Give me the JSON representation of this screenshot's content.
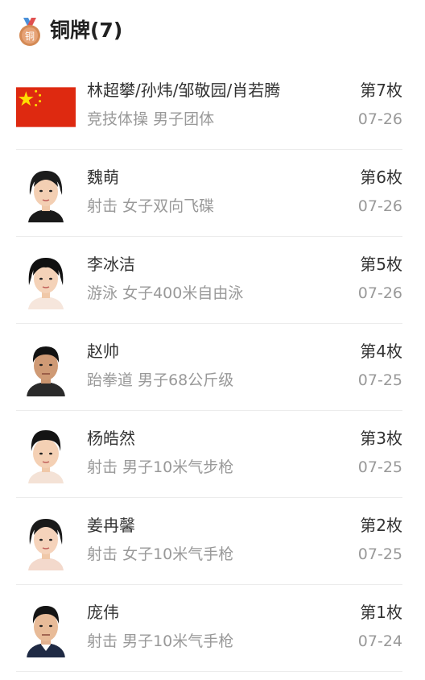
{
  "header": {
    "medal_icon": "bronze-medal-icon",
    "medal_char": "铜",
    "title": "铜牌(7)"
  },
  "colors": {
    "bronze": "#d48a55",
    "flag_red": "#de2910",
    "flag_star": "#ffde00",
    "name_text": "#333333",
    "sub_text": "#999999"
  },
  "medals": [
    {
      "name": "林超攀/孙炜/邹敬园/肖若腾",
      "sport": "竞技体操",
      "event": "男子团体",
      "rank": "第7枚",
      "date": "07-26",
      "avatar": "china-flag-icon"
    },
    {
      "name": "魏萌",
      "sport": "射击",
      "event": "女子双向飞碟",
      "rank": "第6枚",
      "date": "07-26",
      "avatar": "athlete-photo"
    },
    {
      "name": "李冰洁",
      "sport": "游泳",
      "event": "女子400米自由泳",
      "rank": "第5枚",
      "date": "07-26",
      "avatar": "athlete-photo"
    },
    {
      "name": "赵帅",
      "sport": "跆拳道",
      "event": "男子68公斤级",
      "rank": "第4枚",
      "date": "07-25",
      "avatar": "athlete-photo"
    },
    {
      "name": "杨皓然",
      "sport": "射击",
      "event": "男子10米气步枪",
      "rank": "第3枚",
      "date": "07-25",
      "avatar": "athlete-photo"
    },
    {
      "name": "姜冉馨",
      "sport": "射击",
      "event": "女子10米气手枪",
      "rank": "第2枚",
      "date": "07-25",
      "avatar": "athlete-photo"
    },
    {
      "name": "庞伟",
      "sport": "射击",
      "event": "男子10米气手枪",
      "rank": "第1枚",
      "date": "07-24",
      "avatar": "athlete-photo"
    }
  ]
}
